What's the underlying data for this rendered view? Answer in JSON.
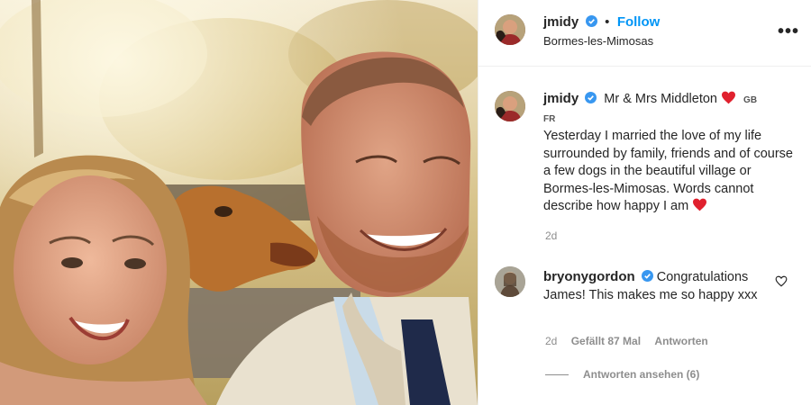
{
  "post": {
    "username": "jmidy",
    "separator": "•",
    "follow_label": "Follow",
    "location": "Bormes-les-Mimosas",
    "more_label": "•••"
  },
  "caption": {
    "username": "jmidy",
    "title": "Mr & Mrs Middleton",
    "flag_gb": "GB",
    "flag_fr": "FR",
    "body": "Yesterday I married the love of my life surrounded by family, friends and of course a few dogs in the beautiful village or Bormes-les-Mimosas. Words cannot describe how happy I am",
    "age": "2d"
  },
  "comment": {
    "username": "bryonygordon",
    "text": "Congratulations James! This makes me so happy xxx",
    "age": "2d",
    "likes": "Gefällt 87 Mal",
    "reply_label": "Antworten",
    "view_replies": "Antworten ansehen (6)"
  },
  "colors": {
    "accent": "#0095f6",
    "heart": "#ed4956",
    "text": "#262626",
    "muted": "#8e8e8e"
  }
}
